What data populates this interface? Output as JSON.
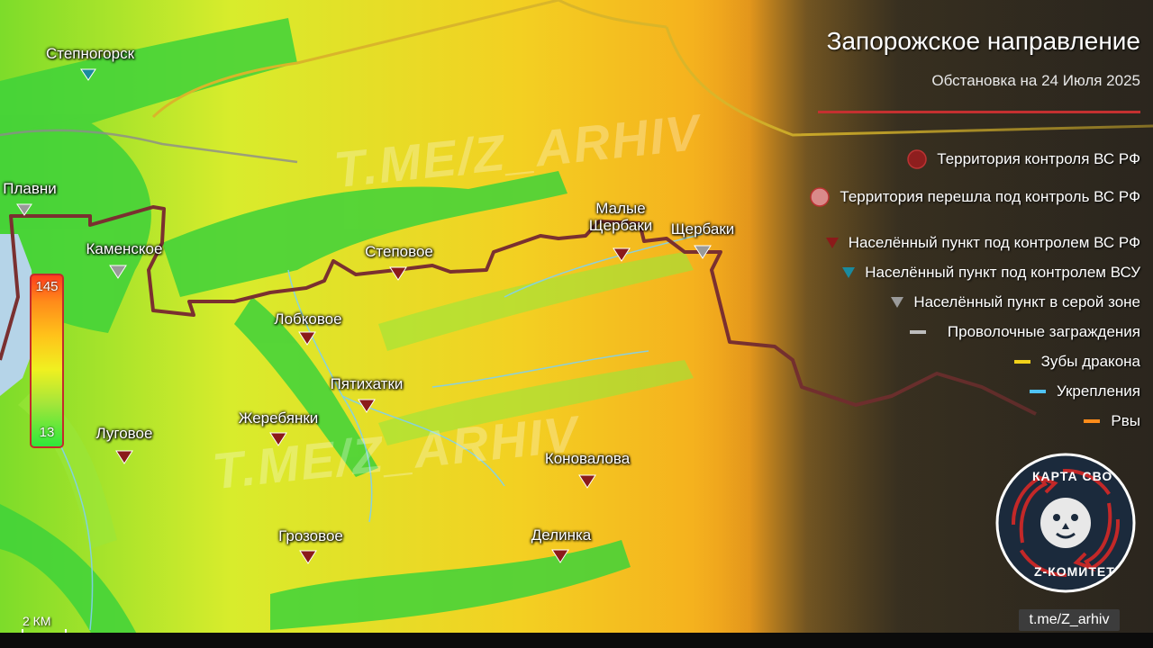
{
  "title": "Запорожское направление",
  "subtitle": "Обстановка на 24 Июля 2025",
  "legend": [
    {
      "symbol": "circle-dark-red",
      "color": "#a11c1c",
      "label": "Территория контроля ВС РФ"
    },
    {
      "symbol": "circle-pink",
      "color": "#d98a8a",
      "label": "Территория перешла под контроль ВС РФ"
    },
    {
      "symbol": "triangle-red",
      "color": "#8b1a1a",
      "label": "Населённый пункт под контролем ВС РФ"
    },
    {
      "symbol": "triangle-blue",
      "color": "#1a8a9e",
      "label": "Населённый пункт под контролем ВСУ"
    },
    {
      "symbol": "triangle-grey",
      "color": "#9a9a9a",
      "label": "Населённый пункт в серой зоне"
    },
    {
      "symbol": "dash-grey",
      "color": "#bdbdbd",
      "label": "Проволочные заграждения"
    },
    {
      "symbol": "dash-yellow",
      "color": "#f2d21a",
      "label": "Зубы дракона"
    },
    {
      "symbol": "dash-lightblue",
      "color": "#4fc3f7",
      "label": "Укрепления"
    },
    {
      "symbol": "dash-orange",
      "color": "#ff8c1a",
      "label": "Рвы"
    }
  ],
  "settlements": [
    {
      "name": "Степногорск",
      "status": "ukraine"
    },
    {
      "name": "Плавни",
      "status": "grey"
    },
    {
      "name": "Каменское",
      "status": "grey"
    },
    {
      "name": "Степовое",
      "status": "russia"
    },
    {
      "name": "Малые Щербаки",
      "status": "russia"
    },
    {
      "name": "Щербаки",
      "status": "grey"
    },
    {
      "name": "Лобковое",
      "status": "russia"
    },
    {
      "name": "Пятихатки",
      "status": "russia"
    },
    {
      "name": "Жеребянки",
      "status": "russia"
    },
    {
      "name": "Луговое",
      "status": "russia"
    },
    {
      "name": "Коновалова",
      "status": "russia"
    },
    {
      "name": "Грозовое",
      "status": "russia"
    },
    {
      "name": "Делинка",
      "status": "russia"
    }
  ],
  "status_colors": {
    "russia": "#8b1a1a",
    "ukraine": "#1a8a9e",
    "grey": "#9a9a9a"
  },
  "elevation_scale": {
    "max": "145",
    "min": "13"
  },
  "scale_label": "2 КМ",
  "watermark": "T.ME/Z_ARHIV",
  "channel_handle": "t.me/Z_arhiv",
  "logo": {
    "top_text": "КАРТА СВО",
    "bottom_text": "Z-КОМИТЕТ"
  }
}
